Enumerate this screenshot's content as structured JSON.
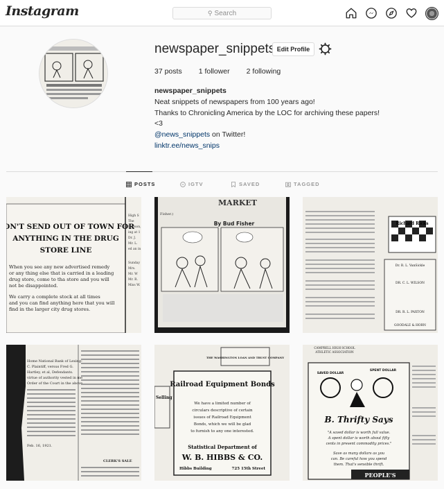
{
  "header": {
    "logo": "Instagram",
    "search_placeholder": "Search",
    "icons": [
      "home-icon",
      "messenger-icon",
      "explore-icon",
      "heart-icon",
      "profile-avatar"
    ]
  },
  "profile": {
    "username": "newspaper_snippets",
    "edit_button": "Edit Profile",
    "stats": {
      "posts": "37 posts",
      "followers": "1 follower",
      "following": "2 following"
    },
    "bio": {
      "name": "newspaper_snippets",
      "line1": "Neat snippets of newspapers from 100 years ago!",
      "line2": "Thanks to Chronicling America by the LOC for archiving these papers!",
      "line3": "<3",
      "twitter_handle": "@news_snippets",
      "twitter_suffix": " on Twitter!",
      "link": "linktr.ee/news_snips"
    }
  },
  "tabs": [
    {
      "label": "POSTS",
      "icon": "grid-icon",
      "active": true
    },
    {
      "label": "IGTV",
      "icon": "igtv-icon",
      "active": false
    },
    {
      "label": "SAVED",
      "icon": "bookmark-icon",
      "active": false
    },
    {
      "label": "TAGGED",
      "icon": "tagged-icon",
      "active": false
    }
  ],
  "posts": [
    {
      "headline": [
        "DON'T SEND OUT OF TOWN FOR",
        "ANYTHING IN THE DRUG",
        "STORE LINE"
      ],
      "body": [
        "When you see any new advertised remedy",
        "or any thing else that is carried in a leading",
        "drug store, come to tha store and you will",
        "not be disappointed.",
        "We carry a complete stock at all times",
        "and you can find anything here that you will",
        "find in the larger city drug stores."
      ],
      "side": [
        "High S",
        "The",
        "Dodson,",
        "ing at 1",
        "Dr. J.",
        "Mr. L.",
        "ed an in",
        "Sunday",
        "Mrs.",
        "Mr. W",
        "Mr. R.",
        "Miss W."
      ]
    },
    {
      "title": "MARKET",
      "subtitle": "By Bud Fisher",
      "caption": "Fisher.)"
    },
    {
      "ad_title": "Richard Ricks",
      "cards": [
        "Dr. R. L. VanSickle",
        "DR. C. L. WILSON",
        "DR. R. L. PAXTON",
        "GOODALE & HORN"
      ]
    },
    {
      "lines": [
        "Home National Bank of Lexing-",
        "C. Plaintiff, versus Fred G.",
        "Hartley, et al, Defendants.",
        "virtue of authority vested in me",
        "Order of the Court in the above",
        "CLERK'S SALE",
        "Feb. 16, 1921."
      ]
    },
    {
      "banner": "THE WASHINGTON LOAN AND TRUST COMPANY",
      "side": "Selling",
      "title": "Railroad Equipment Bonds",
      "body": [
        "We have a limited number of",
        "circulars descriptive of certain",
        "issues of Railroad Equipment",
        "Bonds, which we will be glad",
        "to furnish to any one interested."
      ],
      "dept": "Statistical Department of",
      "company": "W. B. HIBBS & CO.",
      "address_left": "Hibbs Building",
      "address_right": "725 15th Street"
    },
    {
      "heading": [
        "CAMPBELL HIGH SCHOOL",
        "ATHLETIC ASSOCIATION"
      ],
      "saved": "SAVED DOLLAR",
      "spent": "SPENT DOLLAR",
      "title": "B. Thrifty Says",
      "body": [
        "\"A saved dollar is worth full value.",
        "A spent dollar is worth about fifty",
        "cents in present commodity prices.\"",
        "Save as many dollars as you",
        "can. Be careful how you spend",
        "them. That's sensible thrift."
      ],
      "footer": "PEOPLE'S"
    }
  ]
}
